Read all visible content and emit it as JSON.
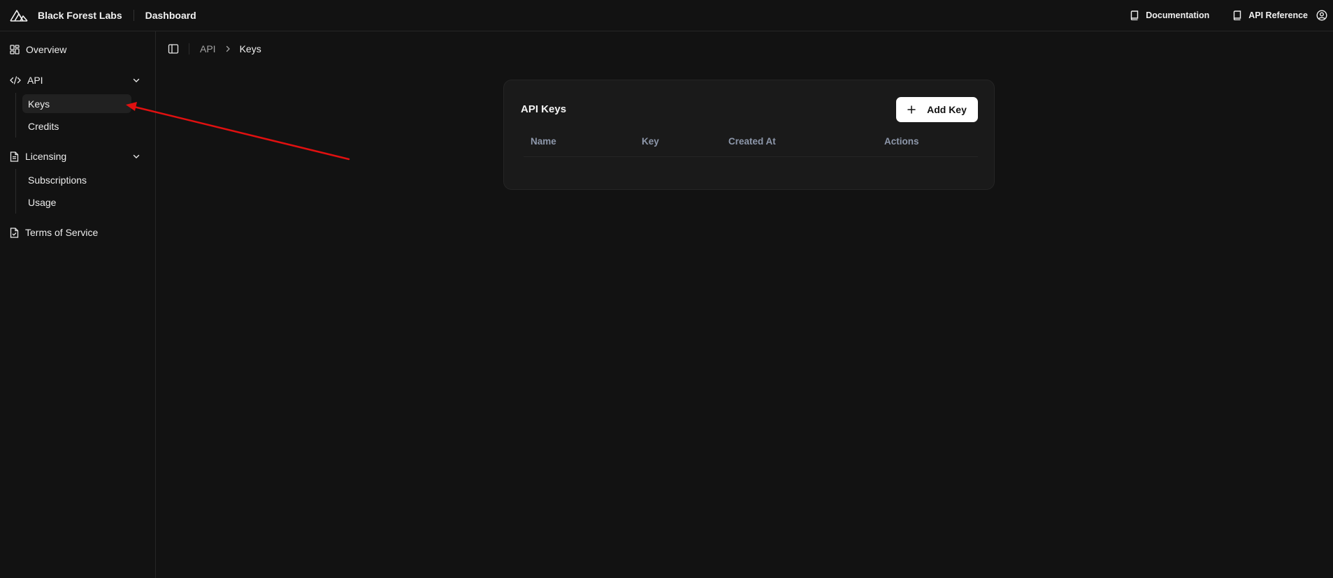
{
  "header": {
    "brand_name": "Black Forest Labs",
    "section": "Dashboard",
    "links": [
      {
        "label": "Documentation",
        "icon": "book-icon"
      },
      {
        "label": "API Reference",
        "icon": "book-icon"
      }
    ],
    "user_icon": "user-circle-icon"
  },
  "sidebar": {
    "overview": "Overview",
    "api": {
      "label": "API",
      "items": [
        "Keys",
        "Credits"
      ],
      "active": "Keys"
    },
    "licensing": {
      "label": "Licensing",
      "items": [
        "Subscriptions",
        "Usage"
      ]
    },
    "terms": "Terms of Service"
  },
  "breadcrumb": [
    "API",
    "Keys"
  ],
  "card": {
    "title": "API Keys",
    "add_button": "Add Key",
    "columns": [
      "Name",
      "Key",
      "Created At",
      "Actions"
    ]
  },
  "colors": {
    "background": "#121212",
    "annotation_arrow": "#e01010"
  }
}
